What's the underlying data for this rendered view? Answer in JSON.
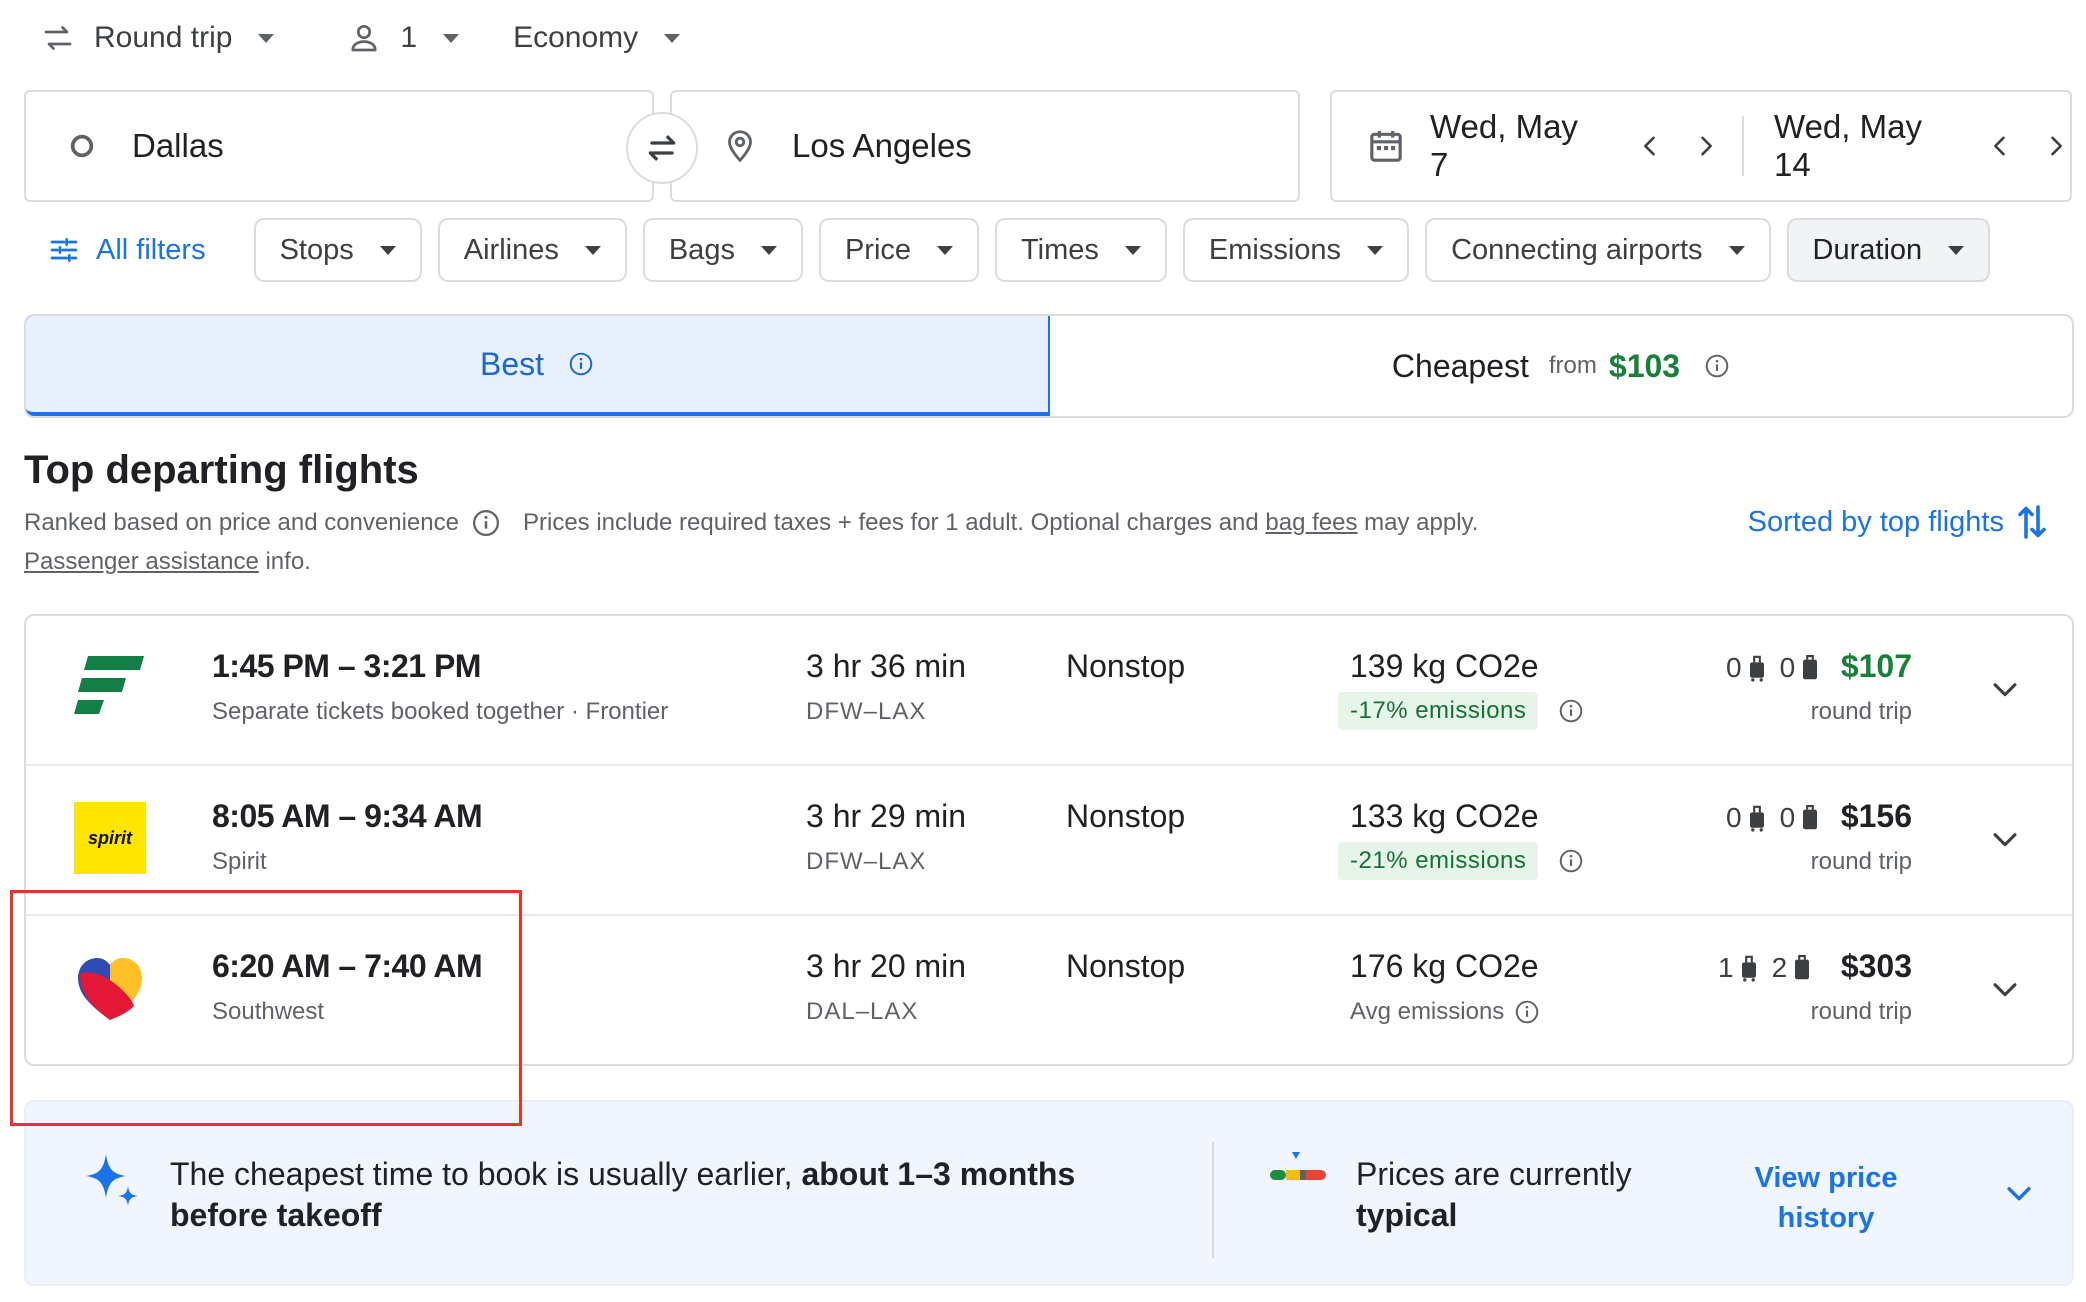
{
  "top": {
    "trip_type": "Round trip",
    "passengers": "1",
    "cabin": "Economy"
  },
  "search": {
    "origin": "Dallas",
    "destination": "Los Angeles",
    "depart_date": "Wed, May 7",
    "return_date": "Wed, May 14"
  },
  "filters": {
    "all_filters": "All filters",
    "chips": [
      "Stops",
      "Airlines",
      "Bags",
      "Price",
      "Times",
      "Emissions",
      "Connecting airports",
      "Duration"
    ]
  },
  "tabs": {
    "best": "Best",
    "cheapest": "Cheapest",
    "from": "from",
    "cheapest_price": "$103"
  },
  "section": {
    "title": "Top departing flights",
    "ranked": "Ranked based on price and convenience",
    "prices_note_1": "Prices include required taxes + fees for 1 adult. Optional charges and",
    "bag_fees": "bag fees",
    "prices_note_2": "may apply.",
    "passenger_assistance": "Passenger assistance",
    "info": "info.",
    "sorted": "Sorted by top flights"
  },
  "flights": [
    {
      "times": "1:45 PM – 3:21 PM",
      "carrier": "Separate tickets booked together · Frontier",
      "duration": "3 hr 36 min",
      "route": "DFW–LAX",
      "stops": "Nonstop",
      "co2": "139 kg CO2e",
      "emissions": "-17% emissions",
      "carry_on": "0",
      "checked": "0",
      "price": "$107",
      "price_type": "round trip",
      "logo": "frontier-logo"
    },
    {
      "times": "8:05 AM – 9:34 AM",
      "carrier": "Spirit",
      "duration": "3 hr 29 min",
      "route": "DFW–LAX",
      "stops": "Nonstop",
      "co2": "133 kg CO2e",
      "emissions": "-21% emissions",
      "carry_on": "0",
      "checked": "0",
      "price": "$156",
      "price_type": "round trip",
      "logo": "spirit-logo",
      "logo_text": "spirit"
    },
    {
      "times": "6:20 AM – 7:40 AM",
      "carrier": "Southwest",
      "duration": "3 hr 20 min",
      "route": "DAL–LAX",
      "stops": "Nonstop",
      "co2": "176 kg CO2e",
      "emissions": "Avg emissions",
      "carry_on": "1",
      "checked": "2",
      "price": "$303",
      "price_type": "round trip",
      "logo": "southwest-logo"
    }
  ],
  "insights": {
    "tip_plain": "The cheapest time to book is usually earlier,",
    "tip_bold": "about 1–3 months before takeoff",
    "price_plain": "Prices are currently",
    "price_bold": "typical",
    "view_link": "View price history"
  },
  "colors": {
    "accent": "#1a73e8",
    "green_price": "#188038",
    "highlight": "#ea3323"
  }
}
